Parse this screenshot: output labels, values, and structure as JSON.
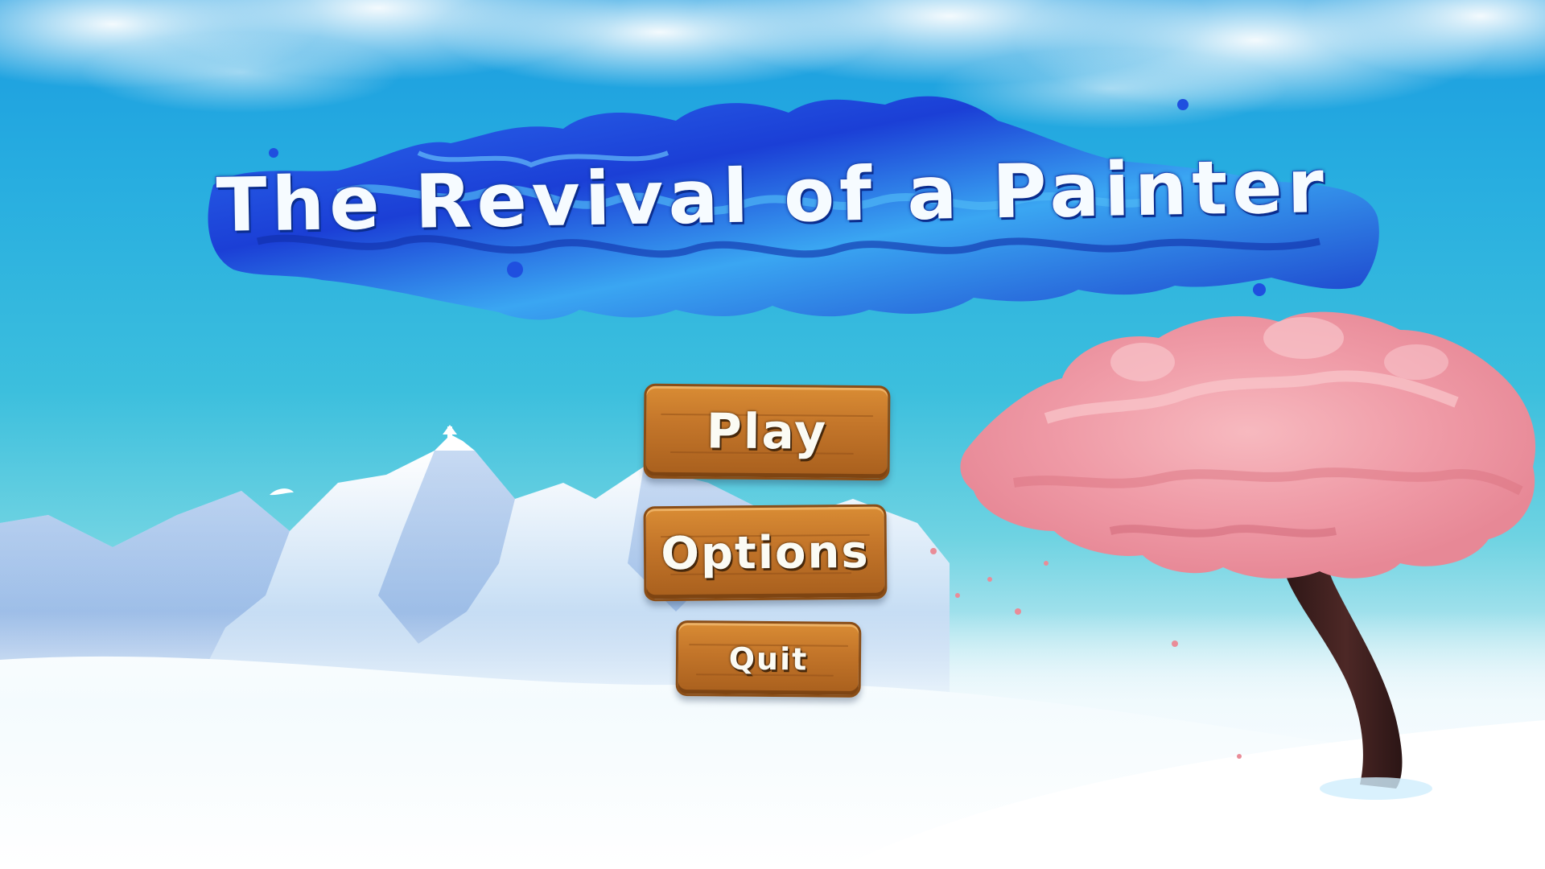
{
  "game": {
    "title": "The Revival of a Painter"
  },
  "menu": {
    "play_label": "Play",
    "options_label": "Options",
    "quit_label": "Quit"
  },
  "colors": {
    "sky_top": "#1a9be0",
    "sky_bottom": "#6fd3e2",
    "title_splash": "#1f5fe0",
    "plank_wood": "#c4762a",
    "blossom": "#f2a0a8",
    "trunk": "#3d1f1c",
    "snow": "#eef8fc"
  },
  "scene": {
    "background": "snowy-mountains",
    "feature": "cherry-blossom-tree"
  }
}
